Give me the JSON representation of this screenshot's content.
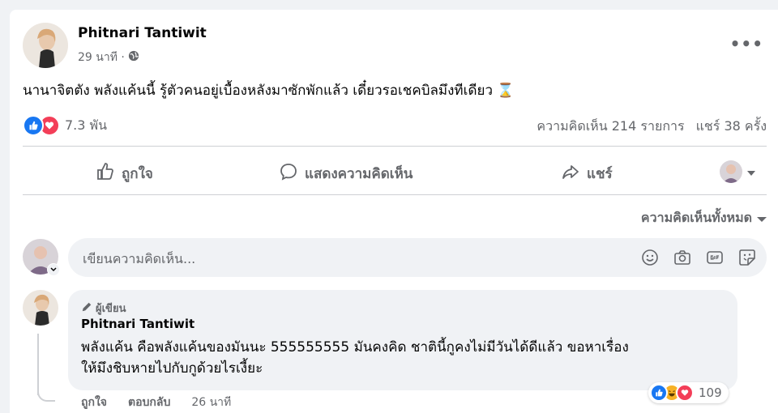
{
  "post": {
    "author_name": "Phitnari Tantiwit",
    "time": "29 นาที ·",
    "privacy_icon": "globe-icon",
    "text": "นานาจิตตัง พลังแค้นนี้ รู้ตัวคนอยู่เบื้องหลังมาซักพักแล้ว เดี๋ยวรอเชคบิลมึงทีเดียว",
    "text_emoji": "⌛",
    "reaction_count": "7.3 พัน",
    "comments_count": "ความคิดเห็น 214 รายการ",
    "shares_count": "แชร์ 38 ครั้ง"
  },
  "actions": {
    "like_label": "ถูกใจ",
    "comment_label": "แสดงความคิดเห็น",
    "share_label": "แชร์"
  },
  "filter": {
    "label": "ความคิดเห็นทั้งหมด"
  },
  "composer": {
    "placeholder": "เขียนความคิดเห็น...",
    "icons": [
      "emoji-icon",
      "camera-icon",
      "gif-icon",
      "sticker-icon"
    ]
  },
  "comment": {
    "badge": "ผู้เขียน",
    "author_name": "Phitnari Tantiwit",
    "text_line1": "พลังแค้น คือพลังแค้นของมันนะ 555555555 มันคงคิด ชาตินี้กูคงไม่มีวันได้ดีแล้ว ขอหาเรื่อง",
    "text_line2": "ให้มึงชิบหายไปกับกูด้วยไรเงี้ยะ",
    "like_label": "ถูกใจ",
    "reply_label": "ตอบกลับ",
    "time": "26 นาที",
    "reaction_count": "109"
  },
  "colors": {
    "like_blue": "#1877f2",
    "love_red": "#f33e58",
    "haha_yellow": "#f7b125",
    "secondary_text": "#65676b",
    "background": "#f0f2f5"
  }
}
